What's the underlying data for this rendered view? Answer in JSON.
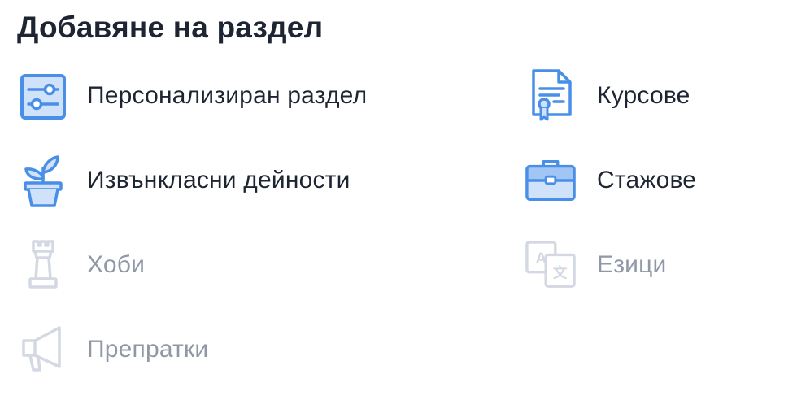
{
  "header": {
    "title": "Добавяне на раздел"
  },
  "colors": {
    "accent": "#4a8fe7",
    "accent_light": "#cfe2fa",
    "text": "#1e2532",
    "disabled_text": "#9097a6",
    "disabled_icon": "#d3d8e2"
  },
  "sections": {
    "personalized": {
      "label": "Персонализиран раздел",
      "icon": "sliders-icon",
      "enabled": true
    },
    "extracurricular": {
      "label": "Извънкласни дейности",
      "icon": "plant-icon",
      "enabled": true
    },
    "hobbies": {
      "label": "Хоби",
      "icon": "chess-rook-icon",
      "enabled": false
    },
    "references": {
      "label": "Препратки",
      "icon": "megaphone-icon",
      "enabled": false
    },
    "courses": {
      "label": "Курсове",
      "icon": "certificate-icon",
      "enabled": true
    },
    "internships": {
      "label": "Стажове",
      "icon": "briefcase-icon",
      "enabled": true
    },
    "languages": {
      "label": "Езици",
      "icon": "translate-icon",
      "enabled": false
    }
  }
}
